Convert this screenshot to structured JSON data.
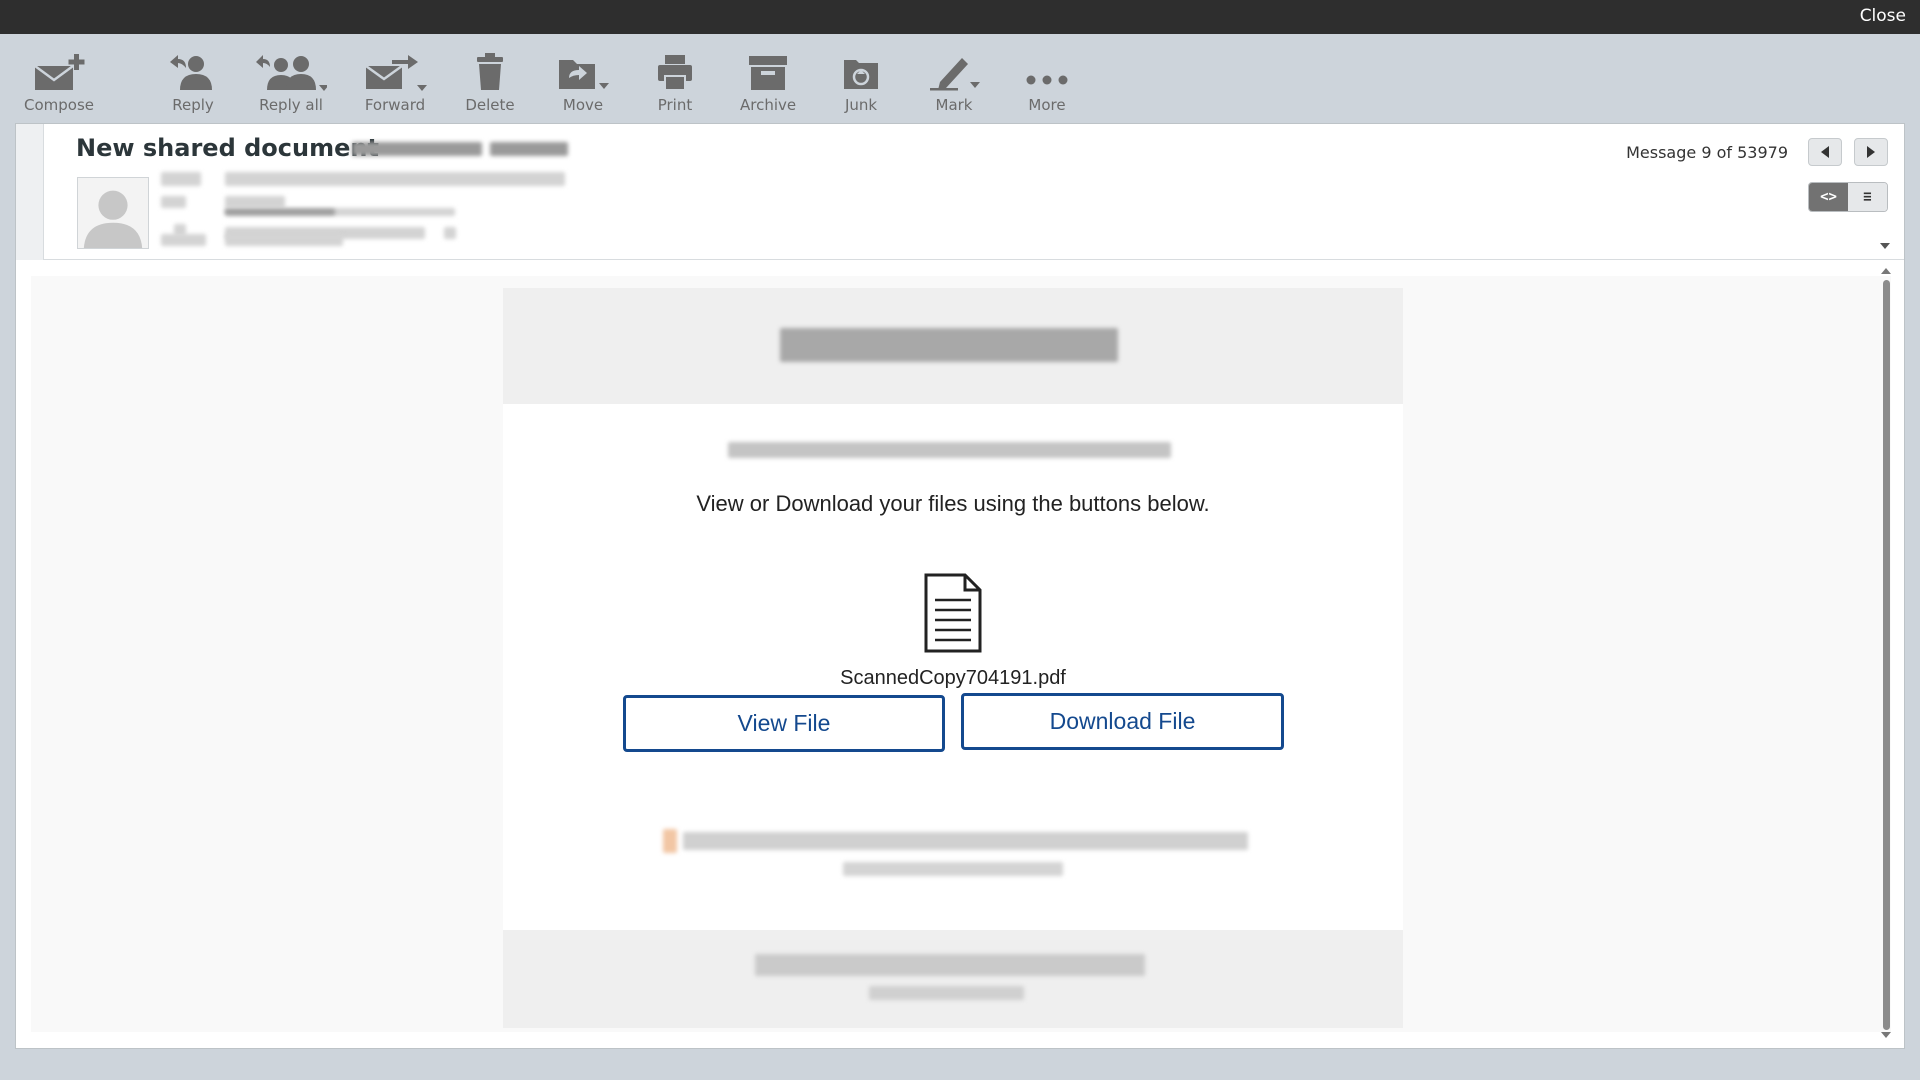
{
  "topbar": {
    "close_label": "Close"
  },
  "toolbar": {
    "items": [
      {
        "label": "Compose",
        "icon": "compose-icon"
      },
      {
        "label": "Reply",
        "icon": "reply-icon"
      },
      {
        "label": "Reply all",
        "icon": "reply-all-icon"
      },
      {
        "label": "Forward",
        "icon": "forward-icon"
      },
      {
        "label": "Delete",
        "icon": "trash-icon"
      },
      {
        "label": "Move",
        "icon": "move-folder-icon"
      },
      {
        "label": "Print",
        "icon": "printer-icon"
      },
      {
        "label": "Archive",
        "icon": "archive-box-icon"
      },
      {
        "label": "Junk",
        "icon": "junk-icon"
      },
      {
        "label": "Mark",
        "icon": "pen-mark-icon"
      },
      {
        "label": "More",
        "icon": "ellipsis-icon"
      }
    ]
  },
  "message": {
    "subject": "New shared document",
    "count_text": "Message 9 of 53979",
    "view_toggle": {
      "html_glyph": "<>",
      "text_glyph": "≡"
    }
  },
  "email_body": {
    "instruction": "View or Download your files using the buttons below.",
    "filename": "ScannedCopy704191.pdf",
    "view_button": "View File",
    "download_button": "Download File"
  },
  "colors": {
    "topbar": "#2e2e2e",
    "toolbar_bg": "#cdd4db",
    "button_border": "#14498e",
    "toolbar_icon": "#6b6b6b"
  }
}
